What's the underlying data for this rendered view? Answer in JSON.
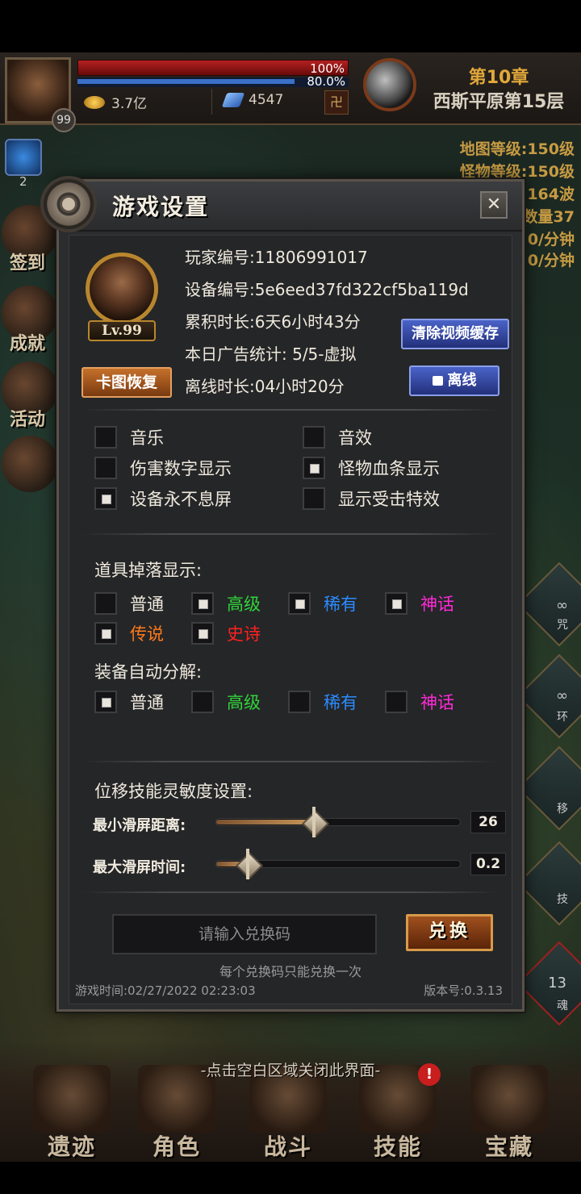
{
  "hud": {
    "level": "99",
    "hp_text": "100%",
    "mp_text": "80.0%",
    "gold": "3.7亿",
    "gems": "4547",
    "chapter": "第10章",
    "stage": "西斯平原第15层",
    "map_level": "地图等级:150级",
    "monster_level": "怪物等级:150级",
    "wave": "164波",
    "count": "数量37",
    "rate1": "0/分钟",
    "rate2": "0/分钟",
    "buff_count": "2"
  },
  "side": {
    "sign_in": "签到",
    "achievement": "成就",
    "activity": "活动"
  },
  "right_slots": [
    "咒",
    "环",
    "移",
    "技",
    "魂"
  ],
  "right_slot_counts": {
    "first": "∞",
    "second": "∞",
    "soul": "13"
  },
  "dialog": {
    "title": "游戏设置",
    "close": "✕",
    "level_badge": "Lv.99",
    "player_id": "玩家编号:11806991017",
    "device_id": "设备编号:5e6eed37fd322cf5ba119d",
    "total_time": "累积时长:6天6小时43分",
    "ad_stats": "本日广告统计:  5/5-虚拟",
    "offline_time": "离线时长:04小时20分",
    "btn_restore": "卡图恢复",
    "btn_clear_cache": "清除视频缓存",
    "btn_offline": "离线",
    "options": {
      "music": {
        "label": "音乐",
        "checked": false
      },
      "sound": {
        "label": "音效",
        "checked": false
      },
      "damage_numbers": {
        "label": "伤害数字显示",
        "checked": false
      },
      "monster_hp": {
        "label": "怪物血条显示",
        "checked": true
      },
      "screen_awake": {
        "label": "设备永不息屏",
        "checked": true
      },
      "hit_effect": {
        "label": "显示受击特效",
        "checked": false
      }
    },
    "drop_title": "道具掉落显示:",
    "drop": [
      {
        "label": "普通",
        "color": "#efe9dd",
        "checked": false
      },
      {
        "label": "高级",
        "color": "#2fd53a",
        "checked": true
      },
      {
        "label": "稀有",
        "color": "#2a8cff",
        "checked": true
      },
      {
        "label": "神话",
        "color": "#ff2ad8",
        "checked": true
      },
      {
        "label": "传说",
        "color": "#ff7a1a",
        "checked": true
      },
      {
        "label": "史诗",
        "color": "#ff2020",
        "checked": true
      }
    ],
    "salvage_title": "装备自动分解:",
    "salvage": [
      {
        "label": "普通",
        "color": "#efe9dd",
        "checked": true
      },
      {
        "label": "高级",
        "color": "#2fd53a",
        "checked": false
      },
      {
        "label": "稀有",
        "color": "#2a8cff",
        "checked": false
      },
      {
        "label": "神话",
        "color": "#ff2ad8",
        "checked": false
      }
    ],
    "sens_title": "位移技能灵敏度设置:",
    "min_swipe_label": "最小滑屏距离:",
    "min_swipe_value": "26",
    "min_swipe_fraction": 0.4,
    "max_time_label": "最大滑屏时间:",
    "max_time_value": "0.2",
    "max_time_fraction": 0.13,
    "code_placeholder": "请输入兑换码",
    "redeem_btn": "兑换",
    "code_hint": "每个兑换码只能兑换一次",
    "game_time": "游戏时间:02/27/2022 02:23:03",
    "version": "版本号:0.3.13"
  },
  "close_hint": "-点击空白区域关闭此界面-",
  "nav": [
    {
      "label": "遗迹"
    },
    {
      "label": "角色"
    },
    {
      "label": "战斗"
    },
    {
      "label": "技能"
    },
    {
      "label": "宝藏"
    }
  ],
  "nav_alert": "!"
}
